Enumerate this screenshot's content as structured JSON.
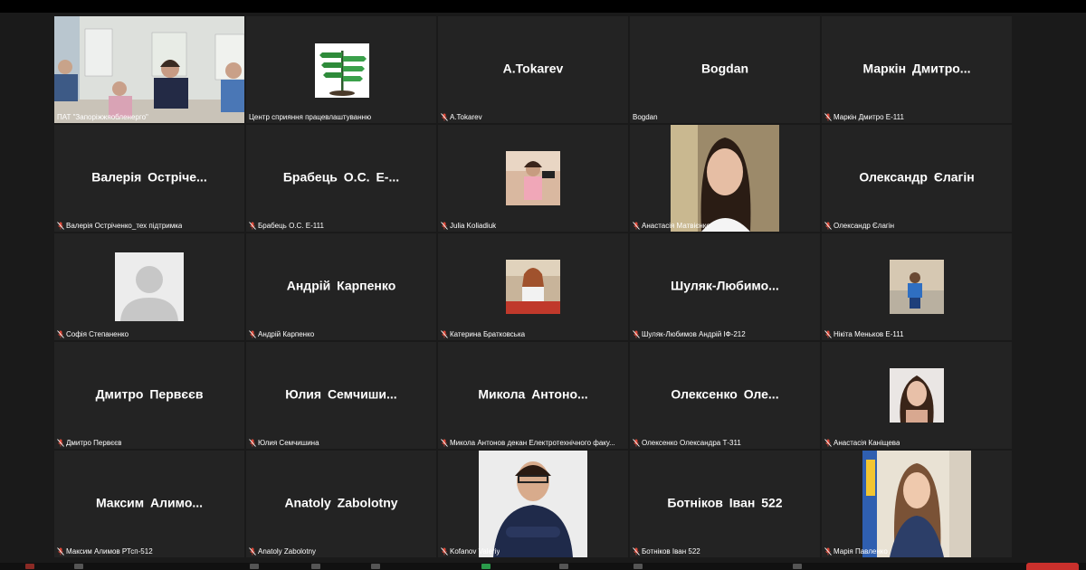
{
  "tiles": [
    {
      "label": "ПАТ \"Запоріжжяобленерго\"",
      "muted": false,
      "kind": "video"
    },
    {
      "label": "Центр сприяння працевлаштуванню",
      "muted": false,
      "kind": "logo"
    },
    {
      "name": "A.Tokarev",
      "label": "A.Tokarev",
      "muted": true,
      "kind": "name"
    },
    {
      "name": "Bogdan",
      "label": "Bogdan",
      "muted": false,
      "kind": "name"
    },
    {
      "name": "Маркін Дмитро...",
      "label": "Маркін Дмитро Е-111",
      "muted": true,
      "kind": "name"
    },
    {
      "name": "Валерія Остріче...",
      "label": "Валерія Острiченко_тех підтримка",
      "muted": true,
      "kind": "name"
    },
    {
      "name": "Брабець О.С. Е-...",
      "label": "Брабець О.С. Е-111",
      "muted": true,
      "kind": "name"
    },
    {
      "label": "Julia Koliadiuk",
      "muted": true,
      "kind": "photo-small-a"
    },
    {
      "label": "Анастасія Матвієнко",
      "muted": true,
      "kind": "photo-large-girl"
    },
    {
      "name": "Олександр Єлагін",
      "label": "Олександр Єлагін",
      "muted": true,
      "kind": "name"
    },
    {
      "label": "Софія Степаненко",
      "muted": true,
      "kind": "avatar"
    },
    {
      "name": "Андрій Карпенко",
      "label": "Андрій Карпенко",
      "muted": true,
      "kind": "name"
    },
    {
      "label": "Катерина Братковська",
      "muted": true,
      "kind": "photo-small-b"
    },
    {
      "name": "Шуляк-Любимо...",
      "label": "Шуляк-Любимов Андрій ІФ-212",
      "muted": true,
      "kind": "name"
    },
    {
      "label": "Нікіта Меньков Е-111",
      "muted": true,
      "kind": "photo-small-c"
    },
    {
      "name": "Дмитро Первєєв",
      "label": "Дмитро Первєєв",
      "muted": true,
      "kind": "name"
    },
    {
      "name": "Юлия Семчиши...",
      "label": "Юлия Семчишина",
      "muted": true,
      "kind": "name"
    },
    {
      "name": "Микола Антоно...",
      "label": "Микола Антонов декан Електротехнічного факу...",
      "muted": true,
      "kind": "name"
    },
    {
      "name": "Олексенко Оле...",
      "label": "Олексенко Олександра Т-311",
      "muted": true,
      "kind": "name"
    },
    {
      "label": "Анастасія Каніщева",
      "muted": true,
      "kind": "photo-small-d"
    },
    {
      "name": "Максим Алимо...",
      "label": "Максим Алимов РТсп-512",
      "muted": true,
      "kind": "name"
    },
    {
      "name": "Anatoly Zabolotny",
      "label": "Anatoly Zabolotny",
      "muted": true,
      "kind": "name"
    },
    {
      "label": "Kofanov Valeriy",
      "muted": true,
      "kind": "photo-large-man"
    },
    {
      "name": "Ботніков Іван 522",
      "label": "Ботніков Іван 522",
      "muted": true,
      "kind": "name"
    },
    {
      "label": "Марія Павленко",
      "muted": true,
      "kind": "photo-large-woman"
    }
  ],
  "colors": {
    "tile_bg": "#232323",
    "active_border": "#cbd47a",
    "mute_red": "#e04a3a",
    "page_bg": "#1a1a1a"
  }
}
